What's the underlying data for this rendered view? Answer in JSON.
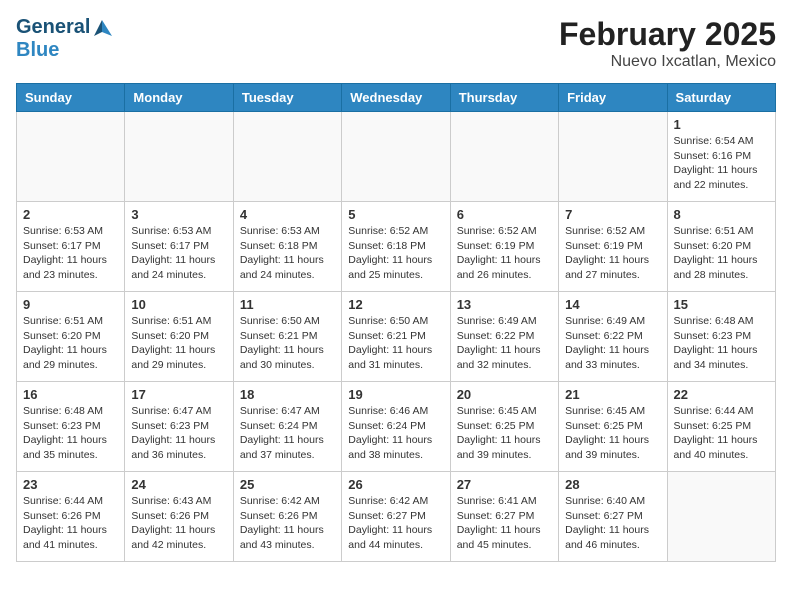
{
  "header": {
    "logo_general": "General",
    "logo_blue": "Blue",
    "month": "February 2025",
    "location": "Nuevo Ixcatlan, Mexico"
  },
  "weekdays": [
    "Sunday",
    "Monday",
    "Tuesday",
    "Wednesday",
    "Thursday",
    "Friday",
    "Saturday"
  ],
  "weeks": [
    [
      {
        "day": "",
        "info": ""
      },
      {
        "day": "",
        "info": ""
      },
      {
        "day": "",
        "info": ""
      },
      {
        "day": "",
        "info": ""
      },
      {
        "day": "",
        "info": ""
      },
      {
        "day": "",
        "info": ""
      },
      {
        "day": "1",
        "info": "Sunrise: 6:54 AM\nSunset: 6:16 PM\nDaylight: 11 hours\nand 22 minutes."
      }
    ],
    [
      {
        "day": "2",
        "info": "Sunrise: 6:53 AM\nSunset: 6:17 PM\nDaylight: 11 hours\nand 23 minutes."
      },
      {
        "day": "3",
        "info": "Sunrise: 6:53 AM\nSunset: 6:17 PM\nDaylight: 11 hours\nand 24 minutes."
      },
      {
        "day": "4",
        "info": "Sunrise: 6:53 AM\nSunset: 6:18 PM\nDaylight: 11 hours\nand 24 minutes."
      },
      {
        "day": "5",
        "info": "Sunrise: 6:52 AM\nSunset: 6:18 PM\nDaylight: 11 hours\nand 25 minutes."
      },
      {
        "day": "6",
        "info": "Sunrise: 6:52 AM\nSunset: 6:19 PM\nDaylight: 11 hours\nand 26 minutes."
      },
      {
        "day": "7",
        "info": "Sunrise: 6:52 AM\nSunset: 6:19 PM\nDaylight: 11 hours\nand 27 minutes."
      },
      {
        "day": "8",
        "info": "Sunrise: 6:51 AM\nSunset: 6:20 PM\nDaylight: 11 hours\nand 28 minutes."
      }
    ],
    [
      {
        "day": "9",
        "info": "Sunrise: 6:51 AM\nSunset: 6:20 PM\nDaylight: 11 hours\nand 29 minutes."
      },
      {
        "day": "10",
        "info": "Sunrise: 6:51 AM\nSunset: 6:20 PM\nDaylight: 11 hours\nand 29 minutes."
      },
      {
        "day": "11",
        "info": "Sunrise: 6:50 AM\nSunset: 6:21 PM\nDaylight: 11 hours\nand 30 minutes."
      },
      {
        "day": "12",
        "info": "Sunrise: 6:50 AM\nSunset: 6:21 PM\nDaylight: 11 hours\nand 31 minutes."
      },
      {
        "day": "13",
        "info": "Sunrise: 6:49 AM\nSunset: 6:22 PM\nDaylight: 11 hours\nand 32 minutes."
      },
      {
        "day": "14",
        "info": "Sunrise: 6:49 AM\nSunset: 6:22 PM\nDaylight: 11 hours\nand 33 minutes."
      },
      {
        "day": "15",
        "info": "Sunrise: 6:48 AM\nSunset: 6:23 PM\nDaylight: 11 hours\nand 34 minutes."
      }
    ],
    [
      {
        "day": "16",
        "info": "Sunrise: 6:48 AM\nSunset: 6:23 PM\nDaylight: 11 hours\nand 35 minutes."
      },
      {
        "day": "17",
        "info": "Sunrise: 6:47 AM\nSunset: 6:23 PM\nDaylight: 11 hours\nand 36 minutes."
      },
      {
        "day": "18",
        "info": "Sunrise: 6:47 AM\nSunset: 6:24 PM\nDaylight: 11 hours\nand 37 minutes."
      },
      {
        "day": "19",
        "info": "Sunrise: 6:46 AM\nSunset: 6:24 PM\nDaylight: 11 hours\nand 38 minutes."
      },
      {
        "day": "20",
        "info": "Sunrise: 6:45 AM\nSunset: 6:25 PM\nDaylight: 11 hours\nand 39 minutes."
      },
      {
        "day": "21",
        "info": "Sunrise: 6:45 AM\nSunset: 6:25 PM\nDaylight: 11 hours\nand 39 minutes."
      },
      {
        "day": "22",
        "info": "Sunrise: 6:44 AM\nSunset: 6:25 PM\nDaylight: 11 hours\nand 40 minutes."
      }
    ],
    [
      {
        "day": "23",
        "info": "Sunrise: 6:44 AM\nSunset: 6:26 PM\nDaylight: 11 hours\nand 41 minutes."
      },
      {
        "day": "24",
        "info": "Sunrise: 6:43 AM\nSunset: 6:26 PM\nDaylight: 11 hours\nand 42 minutes."
      },
      {
        "day": "25",
        "info": "Sunrise: 6:42 AM\nSunset: 6:26 PM\nDaylight: 11 hours\nand 43 minutes."
      },
      {
        "day": "26",
        "info": "Sunrise: 6:42 AM\nSunset: 6:27 PM\nDaylight: 11 hours\nand 44 minutes."
      },
      {
        "day": "27",
        "info": "Sunrise: 6:41 AM\nSunset: 6:27 PM\nDaylight: 11 hours\nand 45 minutes."
      },
      {
        "day": "28",
        "info": "Sunrise: 6:40 AM\nSunset: 6:27 PM\nDaylight: 11 hours\nand 46 minutes."
      },
      {
        "day": "",
        "info": ""
      }
    ]
  ]
}
